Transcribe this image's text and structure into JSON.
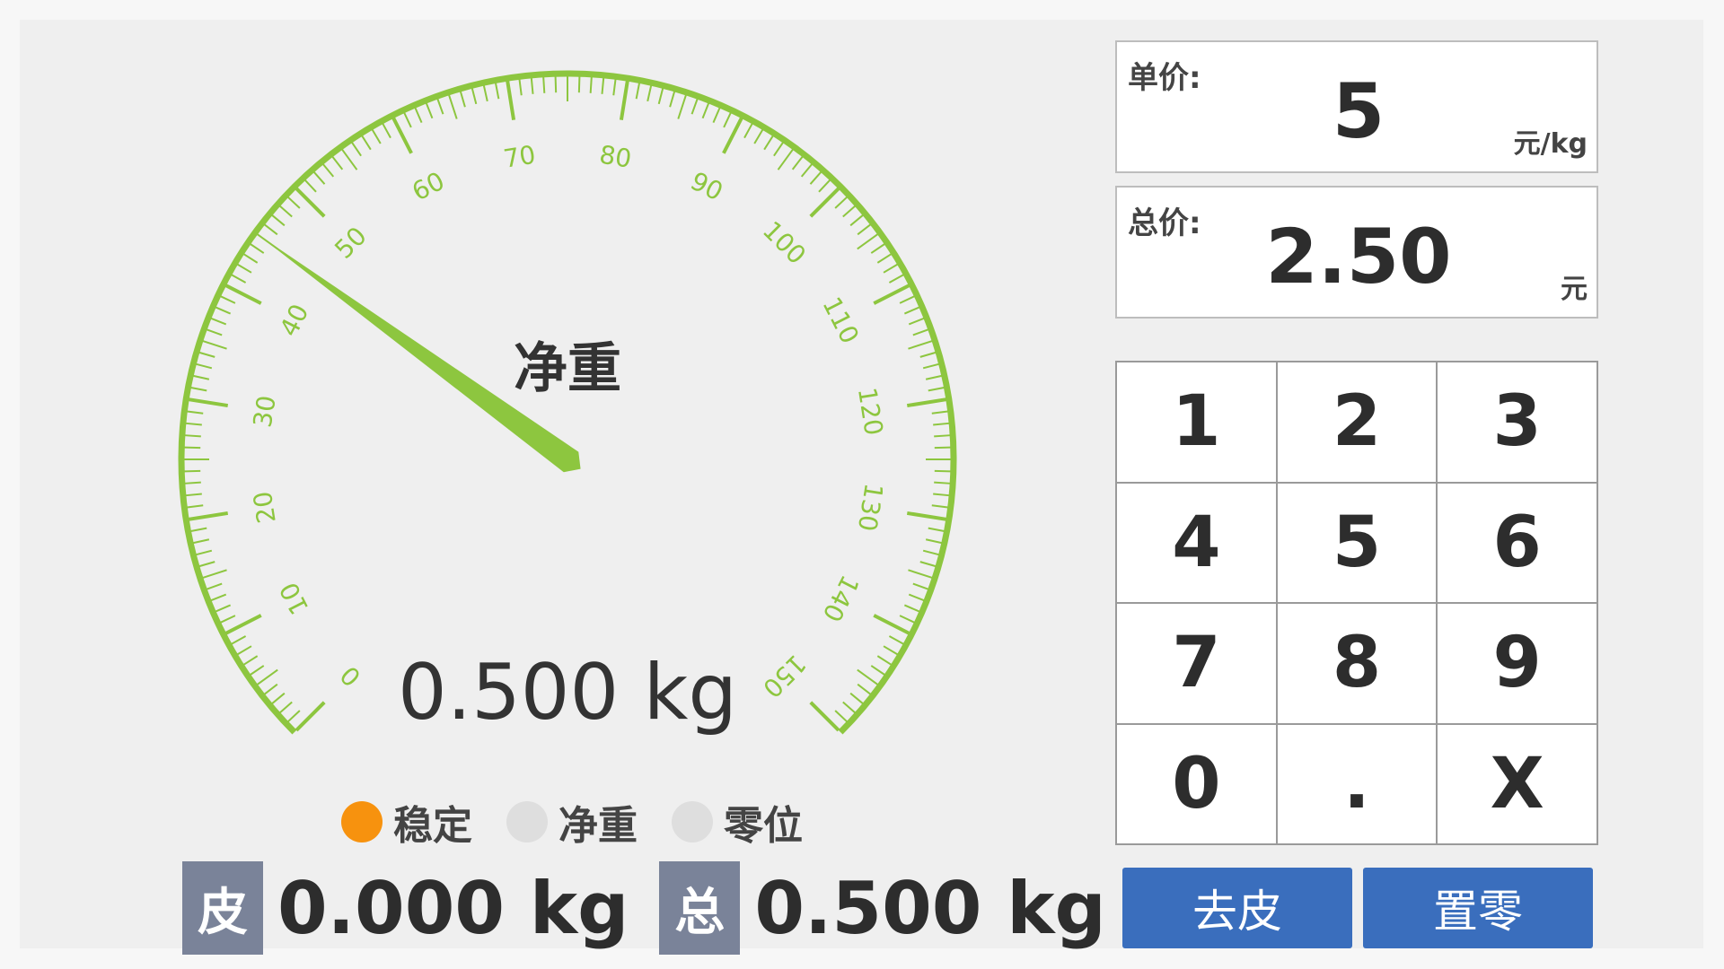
{
  "gauge": {
    "title": "净重",
    "reading": "0.500 kg",
    "min": 0,
    "max": 150,
    "major_step": 10,
    "minor_step": 1,
    "tick_labels": [
      "0",
      "10",
      "20",
      "30",
      "40",
      "50",
      "60",
      "70",
      "80",
      "90",
      "100",
      "110",
      "120",
      "130",
      "140",
      "150"
    ],
    "needle_value": 45,
    "color": "#8dc63f"
  },
  "indicators": [
    {
      "label": "稳定",
      "active": true
    },
    {
      "label": "净重",
      "active": false
    },
    {
      "label": "零位",
      "active": false
    }
  ],
  "tare": {
    "tag": "皮",
    "value": "0.000 kg"
  },
  "total": {
    "tag": "总",
    "value": "0.500 kg"
  },
  "unit_price": {
    "label": "单价:",
    "value": "5",
    "unit": "元/kg"
  },
  "total_price": {
    "label": "总价:",
    "value": "2.50",
    "unit": "元"
  },
  "keypad": {
    "keys": [
      "1",
      "2",
      "3",
      "4",
      "5",
      "6",
      "7",
      "8",
      "9",
      "0",
      ".",
      "X"
    ]
  },
  "buttons": {
    "tare_label": "去皮",
    "zero_label": "置零"
  },
  "colors": {
    "accent": "#8dc63f",
    "button": "#3a6ebd",
    "stable_on": "#f7920e",
    "tag_bg": "#7a8399"
  }
}
